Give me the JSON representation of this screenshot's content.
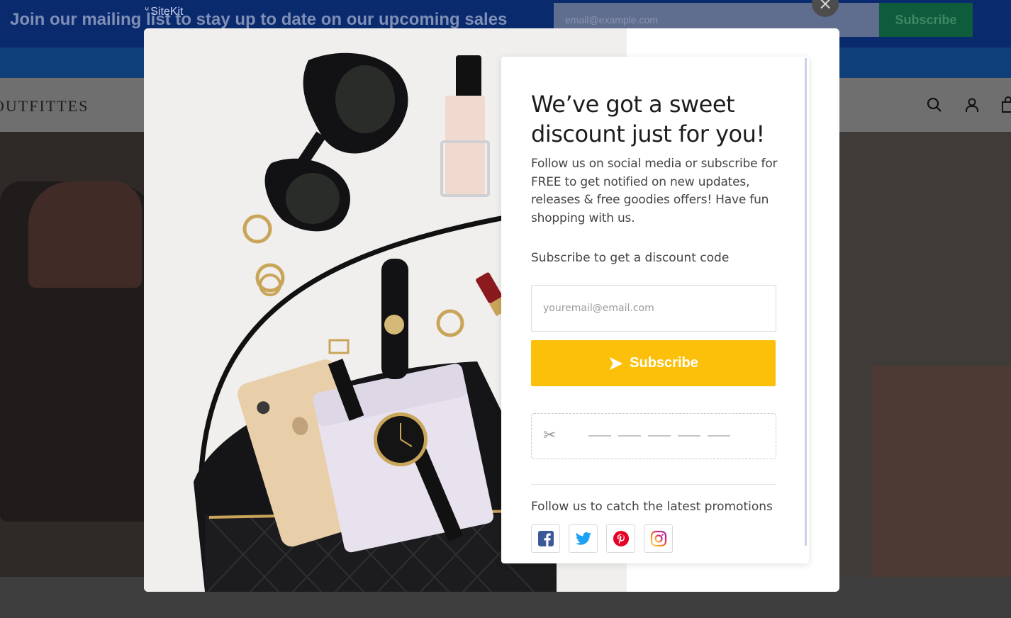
{
  "site": {
    "topbar_text": "Join our mailing list to stay up to date on our upcoming sales",
    "brand_badge": "SiteKit",
    "email_placeholder": "email@example.com",
    "subscribe_label": "Subscribe",
    "logo_text": "OUTFITTES"
  },
  "modal": {
    "close_label": "×",
    "title": "We’ve got a sweet discount just for you!",
    "description": "Follow us on social media or subscribe for FREE to get notified on new updates, releases & free goodies offers! Have fun shopping with us.",
    "subscribe_prompt": "Subscribe to get a discount code",
    "email_placeholder": "youremail@email.com",
    "subscribe_button": "Subscribe",
    "coupon_icon": "✂",
    "follow_text": "Follow us to catch the latest promotions",
    "socials": [
      "facebook-icon",
      "twitter-icon",
      "pinterest-icon",
      "instagram-icon"
    ]
  },
  "colors": {
    "accent_yellow": "#fcc00a",
    "topbar_blue": "#0a2a6e",
    "facebook": "#3b5998",
    "twitter": "#1da1f2",
    "pinterest": "#e60023",
    "instagram": "#e1306c"
  }
}
